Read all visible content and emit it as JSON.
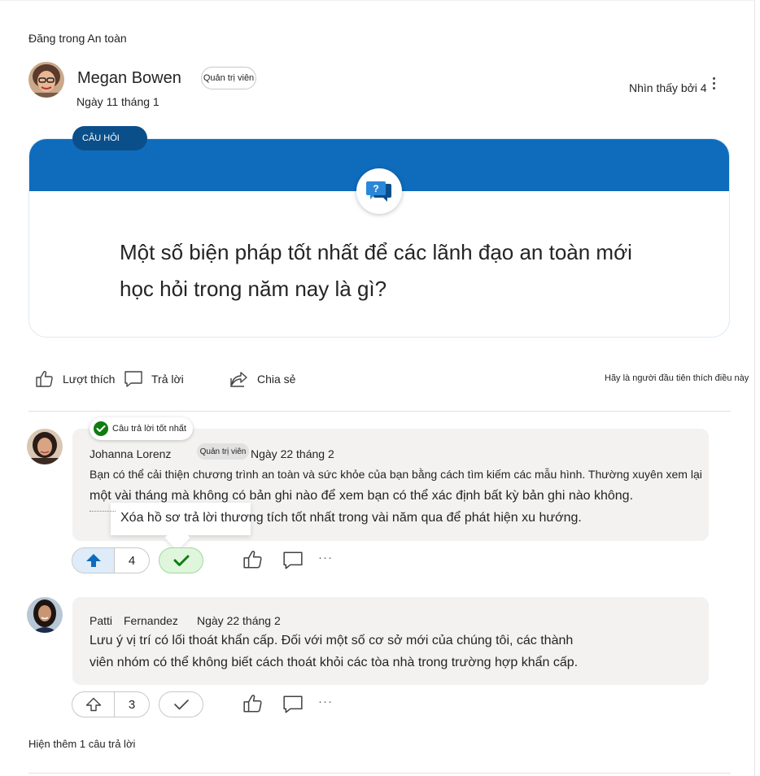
{
  "post": {
    "posted_in": "Đăng trong An toàn",
    "author": "Megan Bowen",
    "role_badge": "Quản trị viên",
    "date": "Ngày 11 tháng 1",
    "seen_by": "Nhìn thấy bởi 4",
    "type_tag": "CÂU HỎI",
    "question": "Một số biện pháp tốt nhất để các lãnh đạo an toàn mới học hỏi trong năm nay là gì?",
    "actions": {
      "like": "Lượt thích",
      "reply": "Trả lời",
      "share": "Chia sẻ"
    },
    "first_like_hint": "Hãy là người đầu tiên thích điều này"
  },
  "replies": [
    {
      "best_answer_label": "Câu trả lời tốt nhất",
      "author": "Johanna Lorenz",
      "role_badge": "Quản trị viên",
      "date": "Ngày 22 tháng 2",
      "lines": [
        "Bạn có thể cải thiện chương trình an toàn và sức khỏe của bạn bằng cách tìm kiếm các mẫu hình. Thường xuyên xem lại",
        "một vài tháng mà không có bản ghi nào để xem bạn có thể xác định bất kỳ bản ghi nào không.",
        "Xóa hồ sơ trả lời thương tích tốt nhất trong vài năm qua để phát hiện xu hướng."
      ],
      "votes": "4",
      "more": "···"
    },
    {
      "author_first": "Patti",
      "author_last": "Fernandez",
      "date": "Ngày 22 tháng 2",
      "lines": [
        "Lưu ý vị trí có lối thoát khẩn cấp. Đối với một số cơ sở mới của chúng tôi, các thành",
        "viên nhóm có thể không biết cách thoát khỏi các tòa nhà trong trường hợp khẩn cấp."
      ],
      "votes": "3",
      "more": "···"
    }
  ],
  "show_more": "Hiện thêm 1 câu trả lời",
  "colors": {
    "brand_blue": "#0f6cbd",
    "tag_blue": "#0b4f8a",
    "success_green": "#107c10",
    "bubble_gray": "#f3f2f1"
  }
}
